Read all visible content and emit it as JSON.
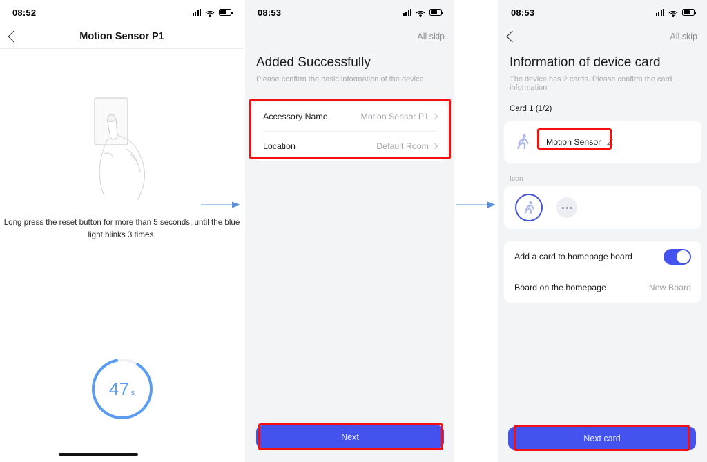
{
  "panels": [
    {
      "id": "pairing",
      "status": {
        "time": "08:52",
        "signal_icon": "signal-bars-icon",
        "wifi_icon": "wifi-icon",
        "battery_icon": "battery-icon"
      },
      "nav": {
        "back_icon": "chevron-left-icon",
        "title": "Motion Sensor P1"
      },
      "illustration": "hand-press-reset-button-illustration",
      "caption": "Long press the reset button for more than 5 seconds, until the blue light blinks 3 times.",
      "timer": {
        "value": "47",
        "unit": "s",
        "progress_percent": 88,
        "ring_color": "#5b9cf0",
        "track_color": "#eef1f5"
      }
    },
    {
      "id": "added-successfully",
      "status": {
        "time": "08:53"
      },
      "nav": {
        "skip_label": "All skip"
      },
      "title": "Added Successfully",
      "subtitle": "Please confirm the basic information of the device",
      "rows": [
        {
          "label": "Accessory Name",
          "value": "Motion Sensor P1",
          "chevron_icon": "chevron-right-icon"
        },
        {
          "label": "Location",
          "value": "Default Room",
          "chevron_icon": "chevron-right-icon"
        }
      ],
      "cta_label": "Next"
    },
    {
      "id": "device-card-info",
      "status": {
        "time": "08:53"
      },
      "nav": {
        "back_icon": "chevron-left-icon",
        "skip_label": "All skip"
      },
      "title": "Information of device card",
      "subtitle": "The device has 2 cards. Please confirm the card information",
      "card_index_label": "Card 1 (1/2)",
      "card_name": {
        "icon": "running-person-icon",
        "value": "Motion Sensor",
        "edit_icon": "pencil-edit-icon"
      },
      "icon_section": {
        "label": "Icon",
        "selected_icon": "running-person-icon",
        "more_icon": "more-dots-icon",
        "selected_ring_color": "#4553d6"
      },
      "settings": [
        {
          "label": "Add a card to homepage board",
          "control": "toggle",
          "value": "on"
        },
        {
          "label": "Board on the homepage",
          "value": "New Board"
        }
      ],
      "cta_label": "Next card"
    }
  ],
  "annotations": {
    "highlight_color": "#f50f0f",
    "boxes": [
      "basic-info-card",
      "card-name-input",
      "next-button",
      "next-card-button"
    ]
  },
  "connectors": {
    "arrow_color": "#6ba4e8",
    "count": 2
  }
}
